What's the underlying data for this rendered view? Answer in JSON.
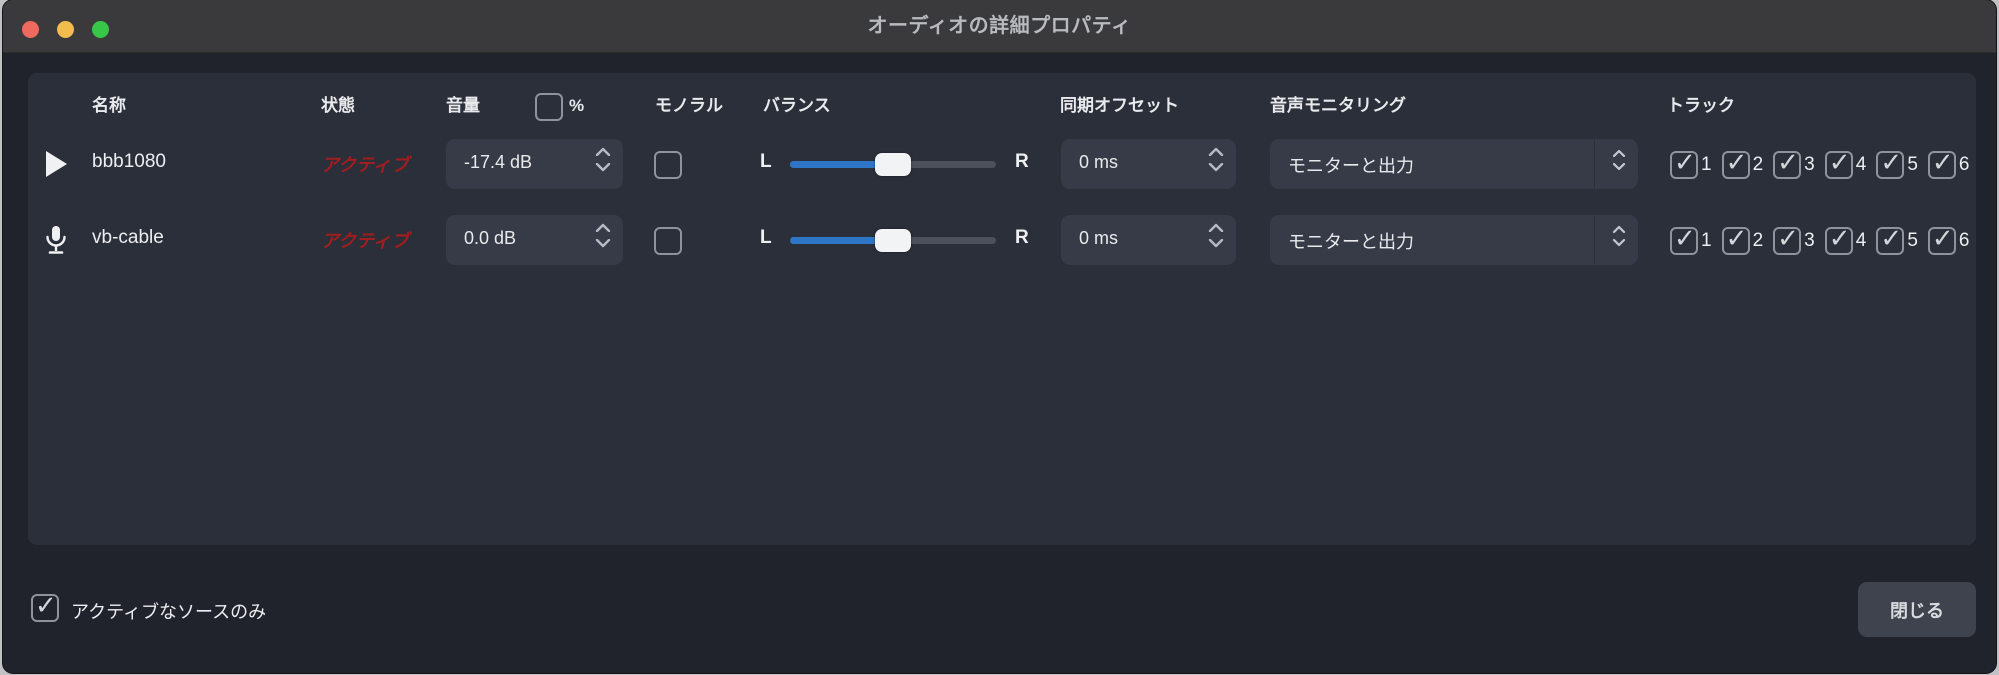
{
  "window": {
    "title": "オーディオの詳細プロパティ"
  },
  "traffic_lights": {
    "close_color": "#ee6a5e",
    "minimize_color": "#f3bd4e",
    "zoom_color": "#37c648"
  },
  "columns": {
    "name": "名称",
    "status": "状態",
    "volume": "音量",
    "volume_percent": "%",
    "mono": "モノラル",
    "balance": "バランス",
    "sync_offset": "同期オフセット",
    "monitoring": "音声モニタリング",
    "tracks": "トラック"
  },
  "header": {
    "percent_checked": false
  },
  "status_color": "#a21d1d",
  "rows": [
    {
      "icon": "play",
      "name": "bbb1080",
      "status": "アクティブ",
      "volume": "-17.4 dB",
      "mono_checked": false,
      "balance_left": "L",
      "balance_right": "R",
      "balance": 0,
      "sync_offset": "0 ms",
      "monitoring": "モニターと出力",
      "tracks": [
        "1",
        "2",
        "3",
        "4",
        "5",
        "6"
      ],
      "tracks_checked": [
        true,
        true,
        true,
        true,
        true,
        true
      ]
    },
    {
      "icon": "microphone",
      "name": "vb-cable",
      "status": "アクティブ",
      "volume": "0.0 dB",
      "mono_checked": false,
      "balance_left": "L",
      "balance_right": "R",
      "balance": 0,
      "sync_offset": "0 ms",
      "monitoring": "モニターと出力",
      "tracks": [
        "1",
        "2",
        "3",
        "4",
        "5",
        "6"
      ],
      "tracks_checked": [
        true,
        true,
        true,
        true,
        true,
        true
      ]
    }
  ],
  "footer": {
    "active_only_label": "アクティブなソースのみ",
    "active_only_checked": true,
    "close_label": "閉じる"
  }
}
